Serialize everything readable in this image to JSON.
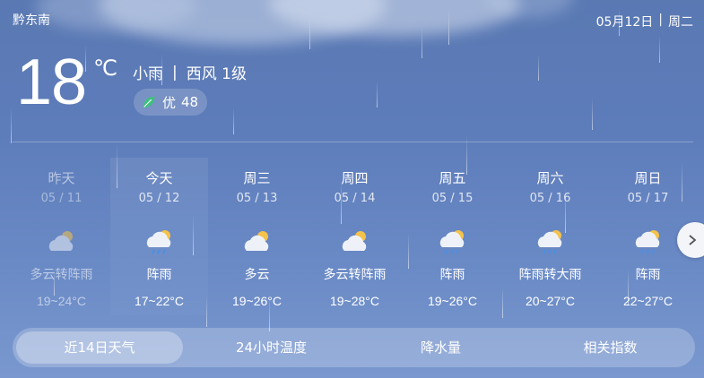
{
  "location": "黔东南",
  "date": "05月12日",
  "weekday": "周二",
  "current": {
    "temperature": "18",
    "unit": "℃",
    "condition": "小雨",
    "wind": "西风 1级",
    "aqi_label": "优",
    "aqi_value": "48"
  },
  "forecast": [
    {
      "name": "昨天",
      "date": "05 / 11",
      "cond": "多云转阵雨",
      "range": "19~24°C",
      "icon": "cloud-sun-icon"
    },
    {
      "name": "今天",
      "date": "05 / 12",
      "cond": "阵雨",
      "range": "17~22°C",
      "icon": "sun-rain-icon"
    },
    {
      "name": "周三",
      "date": "05 / 13",
      "cond": "多云",
      "range": "19~26°C",
      "icon": "cloud-sun-icon"
    },
    {
      "name": "周四",
      "date": "05 / 14",
      "cond": "多云转阵雨",
      "range": "19~28°C",
      "icon": "cloud-sun-icon"
    },
    {
      "name": "周五",
      "date": "05 / 15",
      "cond": "阵雨",
      "range": "19~26°C",
      "icon": "sun-rain-icon"
    },
    {
      "name": "周六",
      "date": "05 / 16",
      "cond": "阵雨转大雨",
      "range": "20~27°C",
      "icon": "sun-rain-icon"
    },
    {
      "name": "周日",
      "date": "05 / 17",
      "cond": "阵雨",
      "range": "22~27°C",
      "icon": "sun-rain-icon"
    }
  ],
  "tabs": [
    "近14日天气",
    "24小时温度",
    "降水量",
    "相关指数"
  ],
  "colors": {
    "leaf": "#3fbf7f",
    "sun": "#f5c24a",
    "cloud": "#eef2f8",
    "rain": "#4a90e2"
  }
}
